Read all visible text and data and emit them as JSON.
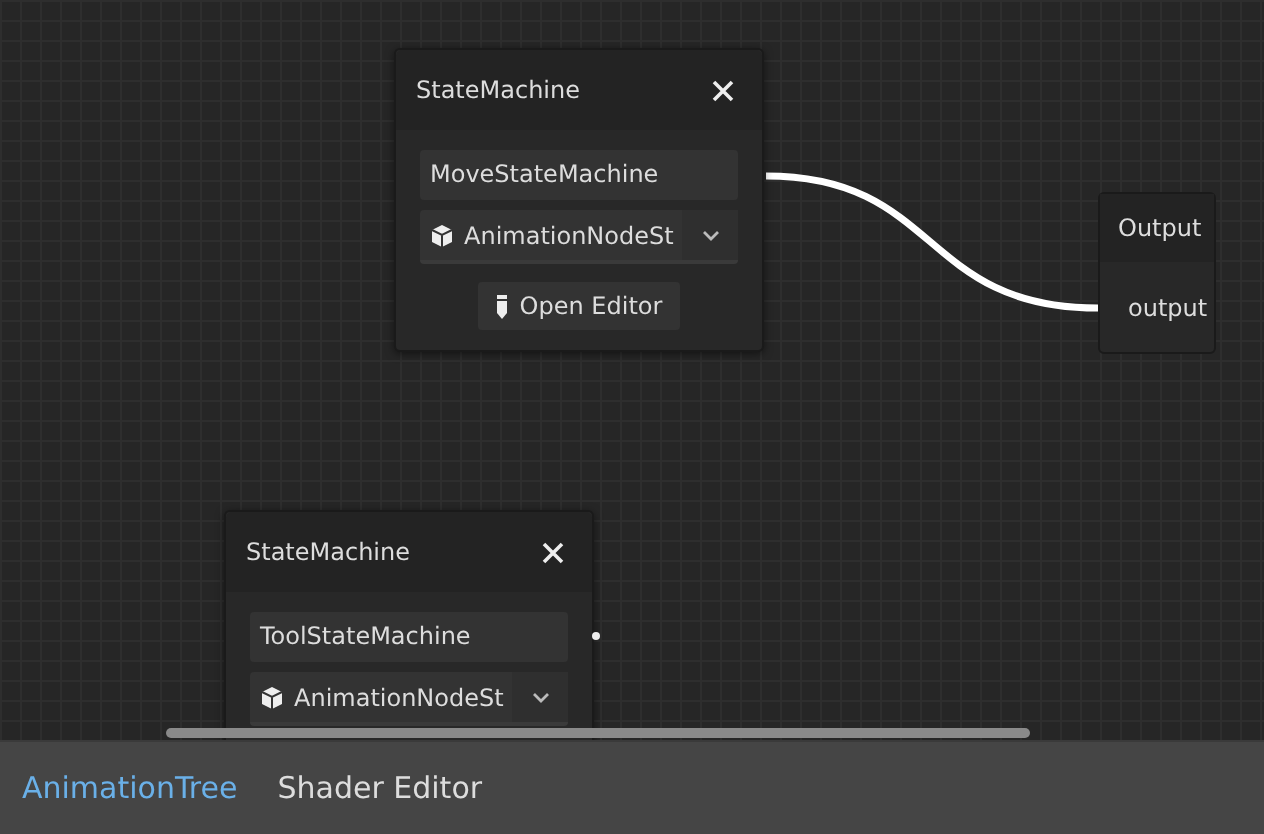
{
  "nodes": [
    {
      "title": "StateMachine",
      "name": "MoveStateMachine",
      "type": "AnimationNodeSt",
      "button": "Open Editor"
    },
    {
      "title": "StateMachine",
      "name": "ToolStateMachine",
      "type": "AnimationNodeSt"
    }
  ],
  "output_node": {
    "title": "Output",
    "port": "output"
  },
  "tabs": [
    {
      "label": "AnimationTree",
      "selected": true
    },
    {
      "label": "Shader Editor",
      "selected": false
    }
  ]
}
